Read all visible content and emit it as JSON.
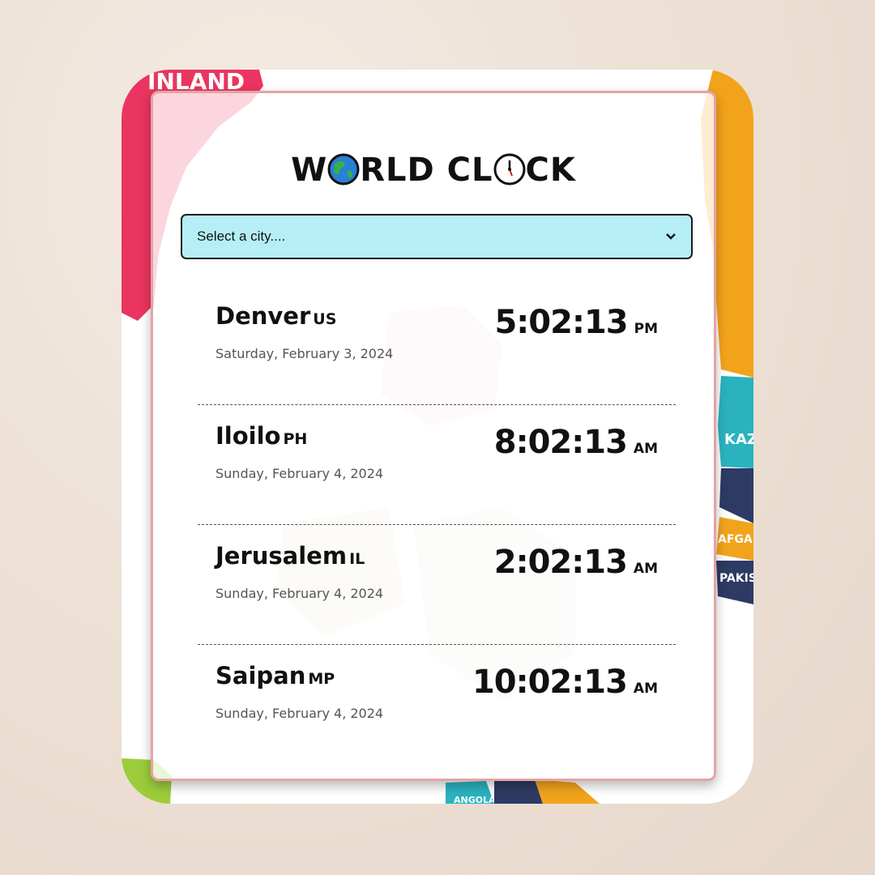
{
  "app": {
    "title_parts": [
      "W",
      "RLD CL",
      "CK"
    ],
    "globe_icon": "globe-icon",
    "clock_icon": "clock-icon"
  },
  "city_select": {
    "placeholder": "Select a city....",
    "arrow_icon": "chevron-down-icon"
  },
  "cities": [
    {
      "name": "Denver",
      "country": "US",
      "date": "Saturday, February 3, 2024",
      "time": "5:02:13",
      "ampm": "PM"
    },
    {
      "name": "Iloilo",
      "country": "PH",
      "date": "Sunday, February 4, 2024",
      "time": "8:02:13",
      "ampm": "AM"
    },
    {
      "name": "Jerusalem",
      "country": "IL",
      "date": "Sunday, February 4, 2024",
      "time": "2:02:13",
      "ampm": "AM"
    },
    {
      "name": "Saipan",
      "country": "MP",
      "date": "Sunday, February 4, 2024",
      "time": "10:02:13",
      "ampm": "AM"
    }
  ],
  "map_labels": [
    "INLAND",
    "KAZ",
    "AFGANIS",
    "PAKIST",
    "ANGOLA"
  ],
  "colors": {
    "select_bg": "#b5eef6",
    "card_border": "#e5a3a7",
    "map_red": "#ea3560",
    "map_orange": "#f2a31c",
    "map_teal": "#2ab3bf",
    "map_navy": "#2d3a63"
  }
}
